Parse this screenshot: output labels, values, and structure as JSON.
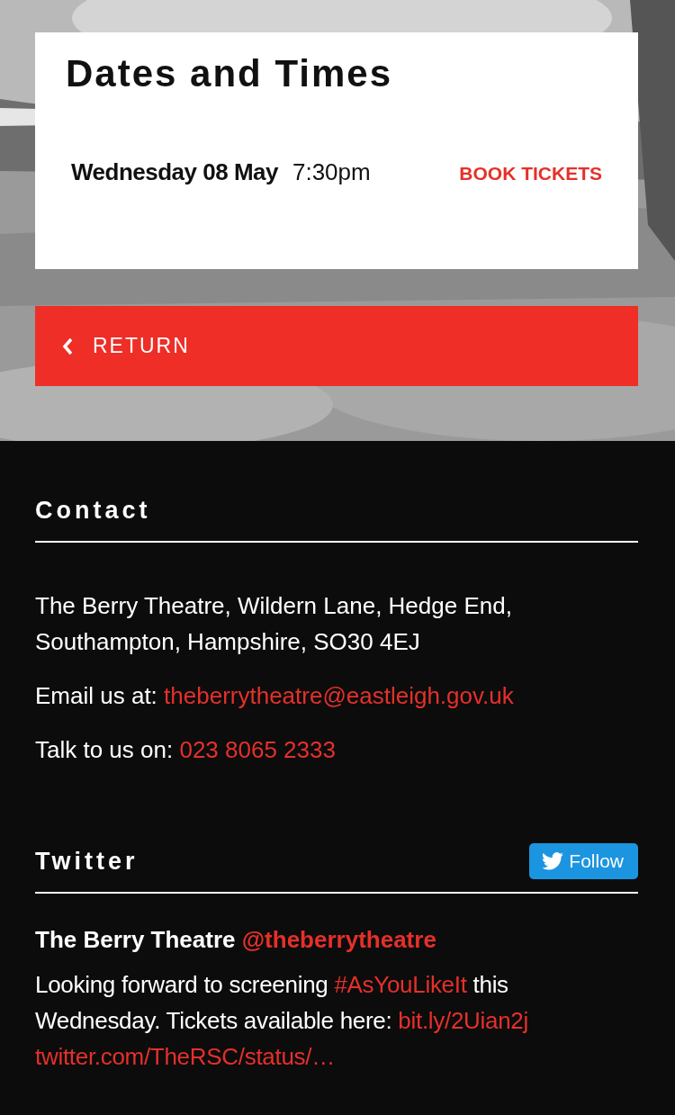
{
  "dates_panel": {
    "title": "Dates and Times",
    "performances": [
      {
        "day": "Wednesday 08 May",
        "time": "7:30pm",
        "action": "BOOK TICKETS"
      }
    ]
  },
  "return_button": {
    "label": "RETURN"
  },
  "contact": {
    "heading": "Contact",
    "address": "The Berry Theatre, Wildern Lane, Hedge End, Southampton, Hampshire, SO30 4EJ",
    "email_label": "Email us at: ",
    "email": "theberrytheatre@eastleigh.gov.uk",
    "phone_label": "Talk to us on: ",
    "phone": "023 8065 2333"
  },
  "twitter": {
    "heading": "Twitter",
    "follow_button": "Follow",
    "tweet": {
      "author": "The Berry Theatre",
      "handle": "@theberrytheatre",
      "parts": [
        {
          "kind": "text",
          "text": "Looking forward to screening "
        },
        {
          "kind": "link",
          "text": "#AsYouLikeIt"
        },
        {
          "kind": "text",
          "text": " this Wednesday. Tickets available here: "
        },
        {
          "kind": "link",
          "text": "bit.ly/2Uian2j"
        },
        {
          "kind": "link",
          "text": "twitter.com/TheRSC/status/…"
        }
      ]
    }
  }
}
